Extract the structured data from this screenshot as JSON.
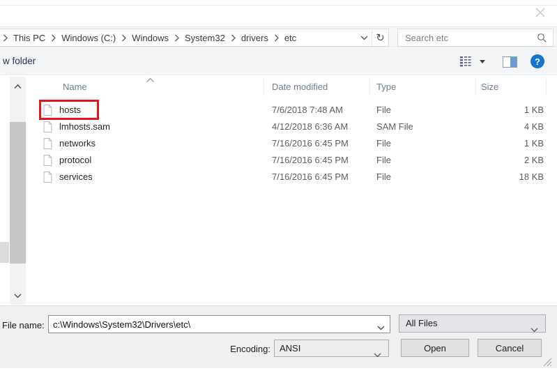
{
  "window": {
    "close_glyph": "×"
  },
  "address_bar": {
    "breadcrumbs": [
      "This PC",
      "Windows (C:)",
      "Windows",
      "System32",
      "drivers",
      "etc"
    ],
    "refresh_glyph": "↻",
    "search_placeholder": "Search etc"
  },
  "toolbar": {
    "new_folder_label": "w folder",
    "help_glyph": "?"
  },
  "file_list": {
    "columns": {
      "name": "Name",
      "date_modified": "Date modified",
      "type": "Type",
      "size": "Size"
    },
    "sorted_column": "Name",
    "highlighted_row": "hosts",
    "rows": [
      {
        "name": "hosts",
        "date_modified": "7/6/2018 7:48 AM",
        "type": "File",
        "size": "1 KB"
      },
      {
        "name": "lmhosts.sam",
        "date_modified": "4/12/2018 6:36 AM",
        "type": "SAM File",
        "size": "4 KB"
      },
      {
        "name": "networks",
        "date_modified": "7/16/2016 6:45 PM",
        "type": "File",
        "size": "1 KB"
      },
      {
        "name": "protocol",
        "date_modified": "7/16/2016 6:45 PM",
        "type": "File",
        "size": "2 KB"
      },
      {
        "name": "services",
        "date_modified": "7/16/2016 6:45 PM",
        "type": "File",
        "size": "18 KB"
      }
    ]
  },
  "footer": {
    "file_name_label": "File name:",
    "file_name_value": "c:\\Windows\\System32\\Drivers\\etc\\",
    "file_type_selected": "All Files",
    "encoding_label": "Encoding:",
    "encoding_selected": "ANSI",
    "open_label": "Open",
    "cancel_label": "Cancel"
  },
  "colors": {
    "highlight_box": "#e8131c",
    "help_icon_bg": "#1574cf",
    "header_text": "#6b7c95",
    "footer_bg": "#f0f0f0"
  }
}
